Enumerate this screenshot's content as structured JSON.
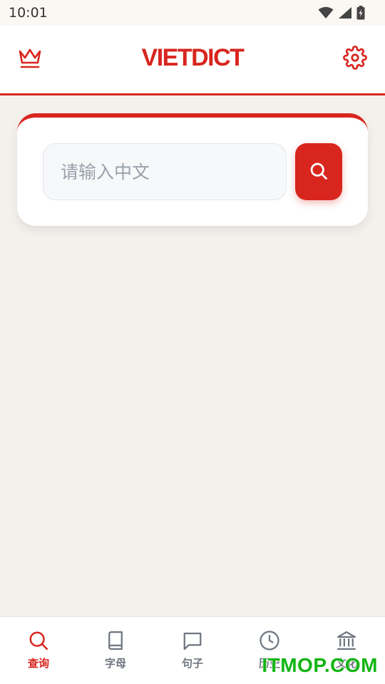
{
  "status_bar": {
    "time": "10:01",
    "icons": [
      "wifi-icon",
      "signal-icon",
      "battery-icon"
    ]
  },
  "header": {
    "title": "VIETDICT",
    "left_icon": "crown-icon",
    "right_icon": "gear-icon"
  },
  "search": {
    "placeholder": "请输入中文",
    "value": "",
    "button_icon": "search-icon"
  },
  "bottom_nav": {
    "items": [
      {
        "label": "查询",
        "icon": "search-icon",
        "active": true
      },
      {
        "label": "字母",
        "icon": "book-icon",
        "active": false
      },
      {
        "label": "句子",
        "icon": "chat-icon",
        "active": false
      },
      {
        "label": "历史",
        "icon": "clock-icon",
        "active": false
      },
      {
        "label": "文化",
        "icon": "landmark-icon",
        "active": false
      }
    ]
  },
  "watermark": "ITMOP.COM",
  "colors": {
    "accent": "#d8261f",
    "background": "#f4f1ec",
    "inactive": "#6f7680",
    "watermark": "#12b512"
  }
}
